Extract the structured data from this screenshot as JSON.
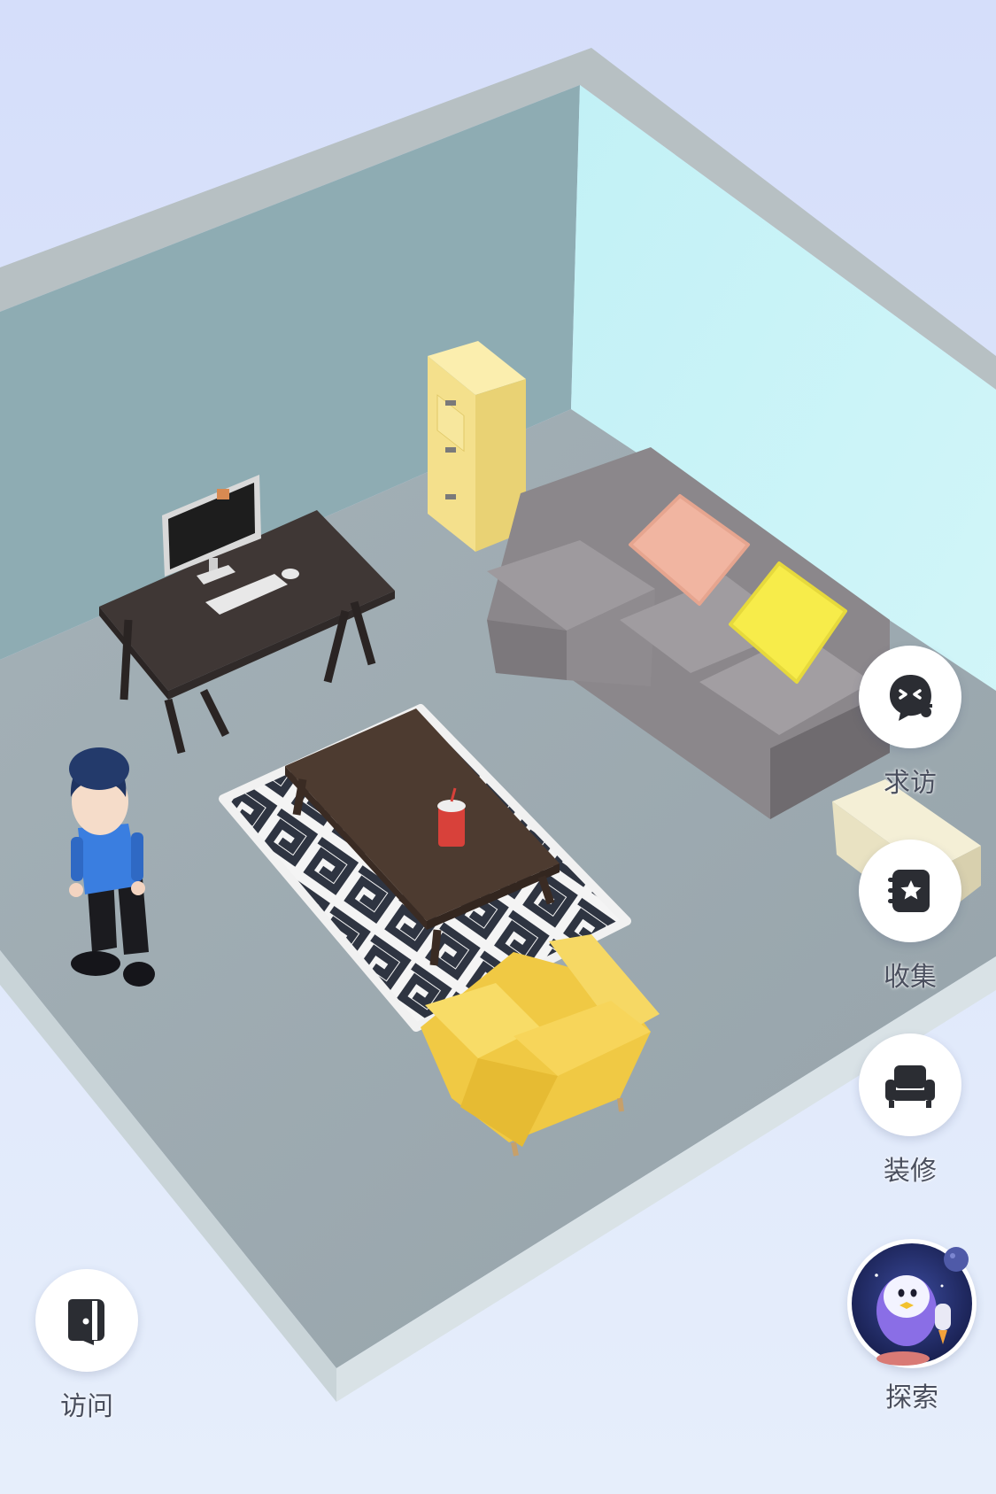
{
  "actions": {
    "visit_request": {
      "label": "求访",
      "icon": "ghost-face-icon"
    },
    "collect": {
      "label": "收集",
      "icon": "star-notebook-icon"
    },
    "decorate": {
      "label": "装修",
      "icon": "armchair-icon"
    },
    "visit": {
      "label": "访问",
      "icon": "door-icon"
    },
    "explore": {
      "label": "探索",
      "icon": "penguin-astronaut-icon"
    }
  },
  "colors": {
    "background": "#dbe4fb",
    "back_wall": "#8fadb4",
    "side_wall": "#c6f3f7",
    "floor": "#9ca9b0",
    "wall_edge": "#b9c2c4",
    "sofa": "#8d888c",
    "armchair": "#f2cf55",
    "desk": "#3d3634",
    "cabinet": "#f4e08e"
  }
}
